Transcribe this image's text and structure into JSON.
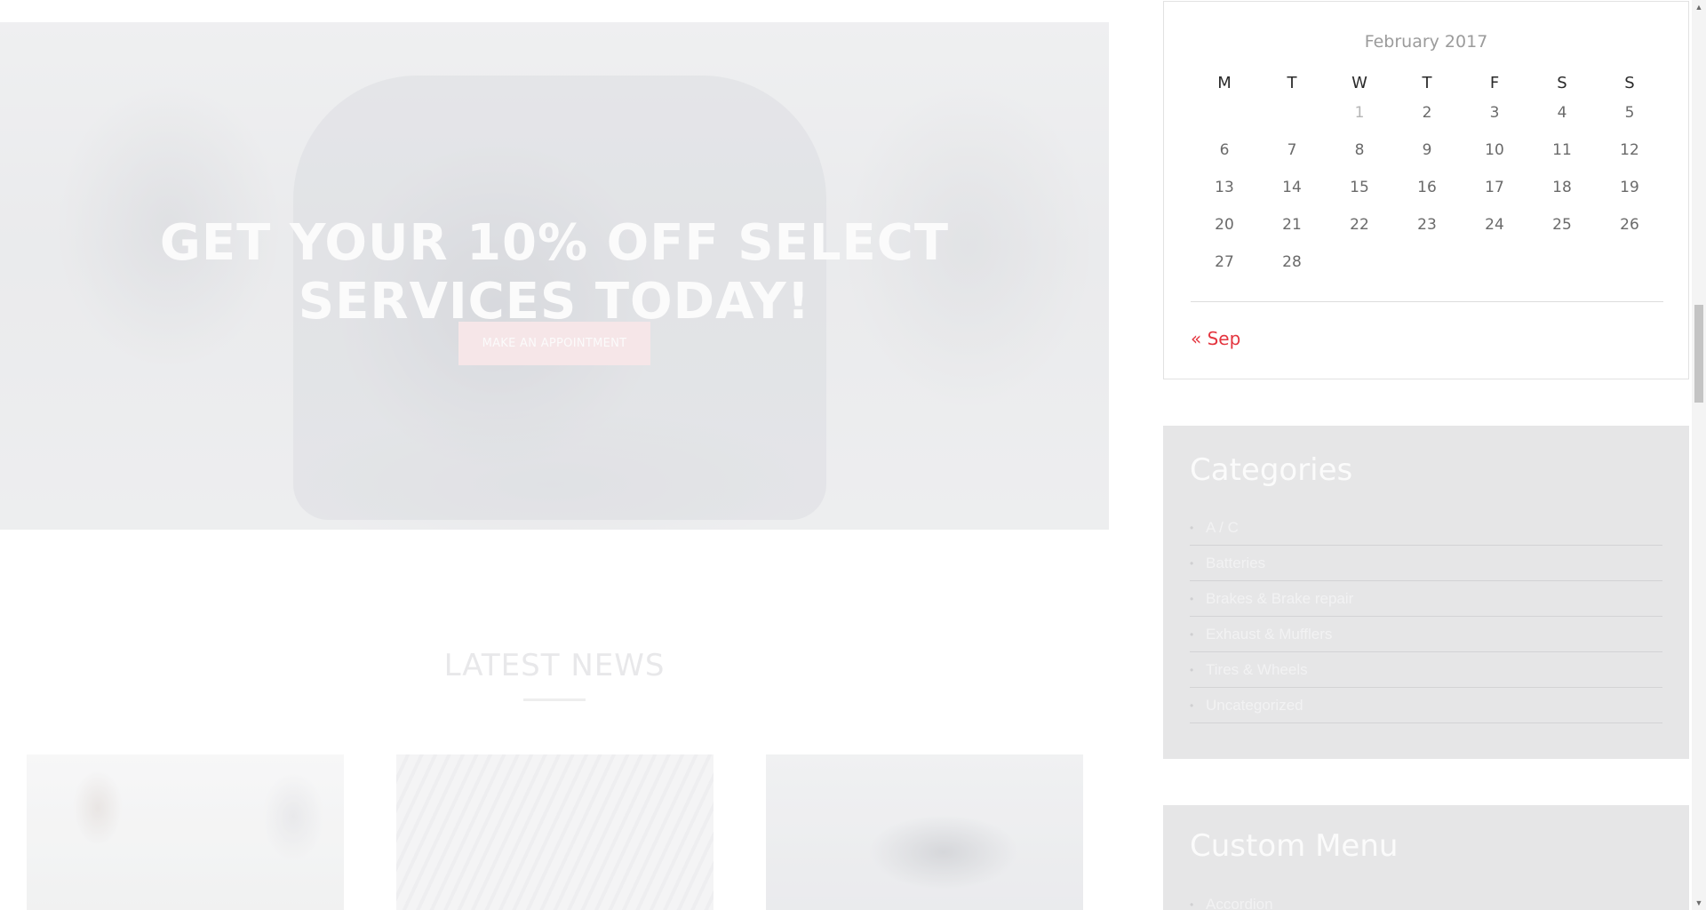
{
  "hero": {
    "title_line1": "GET YOUR 10% OFF SELECT",
    "title_line2": "SERVICES TODAY!",
    "button_label": "MAKE AN APPOINTMENT"
  },
  "news": {
    "heading": "LATEST NEWS"
  },
  "calendar": {
    "caption": "February 2017",
    "weekdays": [
      "M",
      "T",
      "W",
      "T",
      "F",
      "S",
      "S"
    ],
    "weeks": [
      [
        "",
        "",
        "1",
        "2",
        "3",
        "4",
        "5"
      ],
      [
        "6",
        "7",
        "8",
        "9",
        "10",
        "11",
        "12"
      ],
      [
        "13",
        "14",
        "15",
        "16",
        "17",
        "18",
        "19"
      ],
      [
        "20",
        "21",
        "22",
        "23",
        "24",
        "25",
        "26"
      ],
      [
        "27",
        "28",
        "",
        "",
        "",
        "",
        ""
      ]
    ],
    "prev_link": "« Sep"
  },
  "categories": {
    "title": "Categories",
    "items": [
      "A / C",
      "Batteries",
      "Brakes & Brake repair",
      "Exhaust & Mufflers",
      "Tires & Wheels",
      "Uncategorized"
    ]
  },
  "custom_menu": {
    "title": "Custom Menu",
    "items": [
      "Accordion"
    ]
  },
  "colors": {
    "accent": "#e4353f",
    "widget_bg": "#e6e6e7"
  }
}
